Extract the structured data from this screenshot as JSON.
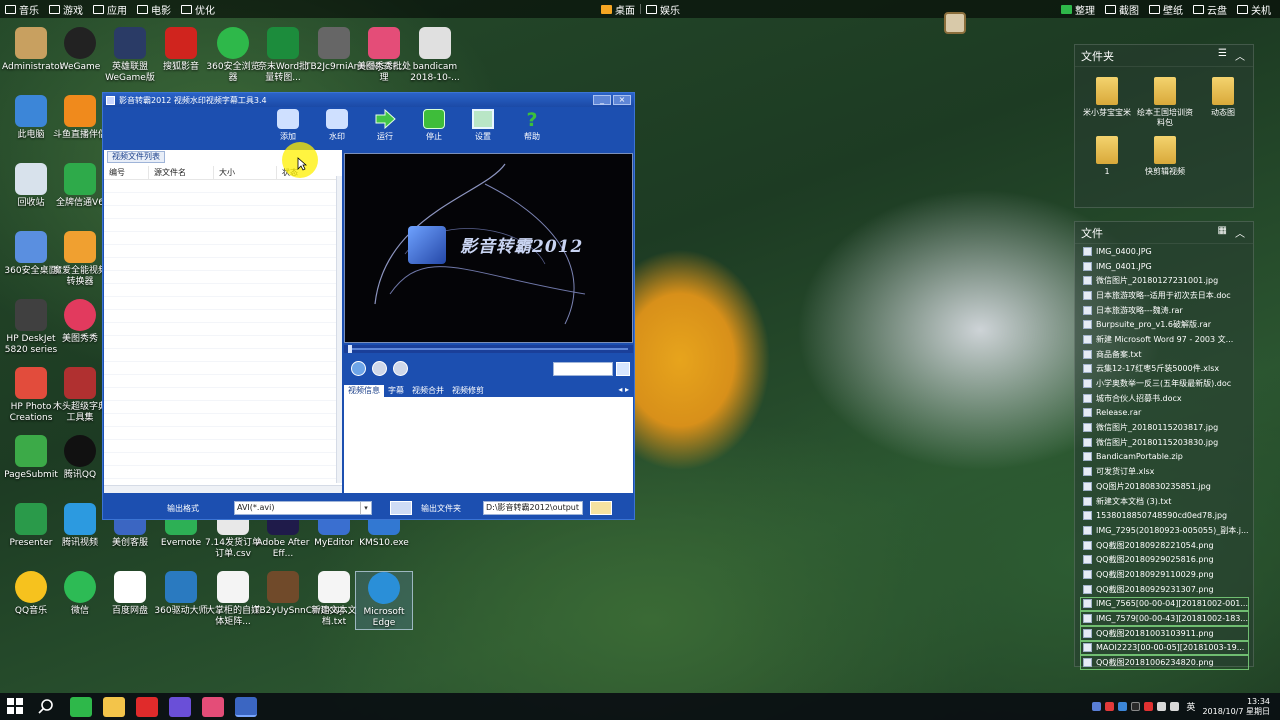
{
  "topbar": {
    "left": [
      {
        "label": "音乐",
        "icon": "music-icon"
      },
      {
        "label": "游戏",
        "icon": "gamepad-icon"
      },
      {
        "label": "应用",
        "icon": "apps-icon"
      },
      {
        "label": "电影",
        "icon": "film-icon"
      },
      {
        "label": "优化",
        "icon": "rocket-icon"
      }
    ],
    "center": [
      {
        "label": "桌面",
        "icon": "windows-icon"
      },
      {
        "label": "娱乐",
        "icon": "star-icon"
      }
    ],
    "right": [
      {
        "label": "整理",
        "icon": "grid-icon"
      },
      {
        "label": "截图",
        "icon": "scissors-icon"
      },
      {
        "label": "壁纸",
        "icon": "image-icon"
      },
      {
        "label": "云盘",
        "icon": "cloud-icon"
      },
      {
        "label": "关机",
        "icon": "power-icon"
      }
    ]
  },
  "desktop_icons": [
    {
      "label": "Administrator",
      "color": "#c8a060"
    },
    {
      "label": "WeGame",
      "color": "#222222"
    },
    {
      "label": "英雄联盟WeGame版",
      "color": "#2a3b66"
    },
    {
      "label": "搜狐影音",
      "color": "#d0241e"
    },
    {
      "label": "360安全浏览器",
      "color": "#2eb84a"
    },
    {
      "label": "奈末Word批量转图...",
      "color": "#1c8c3c"
    },
    {
      "label": "TB2Jc9rniAnBKNjSZF...",
      "color": "#666666"
    },
    {
      "label": "美图秀秀批处理",
      "color": "#e44d78"
    },
    {
      "label": "bandicam 2018-10-...",
      "color": "#e0e0e0"
    },
    {
      "label": "此电脑",
      "color": "#3c86d8"
    },
    {
      "label": "斗鱼直播伴侣",
      "color": "#f08a1c"
    },
    {
      "label": "回收站",
      "color": "#d8e2ec"
    },
    {
      "label": "全牌信通V6",
      "color": "#2eaa4a"
    },
    {
      "label": "360安全桌面",
      "color": "#5a8fe0"
    },
    {
      "label": "魔爱全能视频转换器",
      "color": "#f0a030"
    },
    {
      "label": "HP DeskJet 5820 series",
      "color": "#404040"
    },
    {
      "label": "美图秀秀",
      "color": "#e23a5e"
    },
    {
      "label": "HP Photo Creations",
      "color": "#e24c3c"
    },
    {
      "label": "木头超级字典工具集",
      "color": "#b03030"
    },
    {
      "label": "PageSubmit",
      "color": "#3caa48"
    },
    {
      "label": "腾讯QQ",
      "color": "#111111"
    },
    {
      "label": "Presenter",
      "color": "#2a9a4a"
    },
    {
      "label": "腾讯视频",
      "color": "#2c9ae0"
    },
    {
      "label": "美创客服",
      "color": "#3b66c2"
    },
    {
      "label": "Evernote",
      "color": "#2db055"
    },
    {
      "label": "7.14发货订单订单.csv",
      "color": "#e8e8e8"
    },
    {
      "label": "Adobe After Eff...",
      "color": "#1f1b4a"
    },
    {
      "label": "MyEditor",
      "color": "#3a6fd0"
    },
    {
      "label": "KMS10.exe",
      "color": "#3278d2"
    },
    {
      "label": "QQ音乐",
      "color": "#f6c21e"
    },
    {
      "label": "微信",
      "color": "#2dbb55"
    },
    {
      "label": "百度网盘",
      "color": "#ffffff"
    },
    {
      "label": "360驱动大师",
      "color": "#2a7ac0"
    },
    {
      "label": "大掌柜的自媒体矩阵...",
      "color": "#f4f4f4"
    },
    {
      "label": "TB2yUySnnCWBKNj...",
      "color": "#704a2a"
    },
    {
      "label": "新建文本文档.txt",
      "color": "#f5f5f5"
    },
    {
      "label": "Microsoft Edge",
      "color": "#2a8fd8"
    }
  ],
  "app": {
    "title": "影音转霸2012 视频水印视频字幕工具3.4",
    "window_buttons": [
      "_",
      "×"
    ],
    "toolbar": [
      {
        "label": "添加",
        "icon": "add-film-icon",
        "color": "#cfe0ff"
      },
      {
        "label": "水印",
        "icon": "watermark-icon",
        "color": "#cfe0ff"
      },
      {
        "label": "运行",
        "icon": "run-arrow-icon",
        "color": "#42c548"
      },
      {
        "label": "停止",
        "icon": "stop-icon",
        "color": "#3ebd3a"
      },
      {
        "label": "设置",
        "icon": "settings-screen-icon",
        "color": "#b9e6c6"
      },
      {
        "label": "帮助",
        "icon": "help-icon",
        "color": "#3cbf3c"
      }
    ],
    "file_list": {
      "tab": "视频文件列表",
      "columns": [
        "编号",
        "源文件名",
        "大小",
        "状态"
      ]
    },
    "preview": {
      "logo_text": "影音转霸2012"
    },
    "info_tabs": [
      "视频信息",
      "字幕",
      "视频合并",
      "视频修剪"
    ],
    "bottom": {
      "format_label": "输出格式",
      "format_value": "AVI(*.avi)",
      "folder_label": "输出文件夹",
      "folder_value": "D:\\影音转霸2012\\output"
    }
  },
  "widgets": {
    "folders": {
      "title": "文件夹",
      "items": [
        "米小芽宝宝米",
        "绘本王国培训资料包",
        "动态图",
        "1",
        "快剪辑视频"
      ]
    },
    "files": {
      "title": "文件",
      "items": [
        "IMG_0400.JPG",
        "IMG_0401.JPG",
        "微信图片_20180127231001.jpg",
        "日本旅游攻略--适用于初次去日本.doc",
        "日本旅游攻略---魏涛.rar",
        "Burpsuite_pro_v1.6破解版.rar",
        "新建 Microsoft Word 97 - 2003 文...",
        "商品备案.txt",
        "云集12-17红枣5斤装5000件.xlsx",
        "小学奥数举一反三(五年级最新版).doc",
        "城市合伙人招募书.docx",
        "Release.rar",
        "微信图片_20180115203817.jpg",
        "微信图片_20180115203830.jpg",
        "BandicamPortable.zip",
        "可发货订单.xlsx",
        "QQ图片20180830235851.jpg",
        "新建文本文档 (3).txt",
        "1538018850748590cd0ed78.jpg",
        "IMG_7295(20180923-005055)_副本.j...",
        "QQ截图20180928221054.png",
        "QQ截图20180929025816.png",
        "QQ截图20180929110029.png",
        "QQ截图20180929231307.png",
        "IMG_7565[00-00-04][20181002-001...",
        "IMG_7579[00-00-43][20181002-183...",
        "QQ截图20181003103911.png",
        "MAOI2223[00-00-05][20181003-19...",
        "QQ截图20181006234820.png"
      ],
      "boxed_from": 24
    }
  },
  "taskbar": {
    "icons": [
      {
        "name": "start-icon",
        "color": "#ffffff"
      },
      {
        "name": "search-icon",
        "color": "#ffffff"
      },
      {
        "name": "360-browser-icon",
        "color": "#2eb84a"
      },
      {
        "name": "file-explorer-icon",
        "color": "#f3c44a"
      },
      {
        "name": "record-icon",
        "color": "#e02b2b"
      },
      {
        "name": "after-effects-icon",
        "color": "#6a4fd8"
      },
      {
        "name": "meitu-icon",
        "color": "#e44d78"
      },
      {
        "name": "yingyin-app-icon",
        "color": "#3b66c2"
      }
    ],
    "ime": "英",
    "time": "13:34",
    "date": "2018/10/7 星期日"
  }
}
